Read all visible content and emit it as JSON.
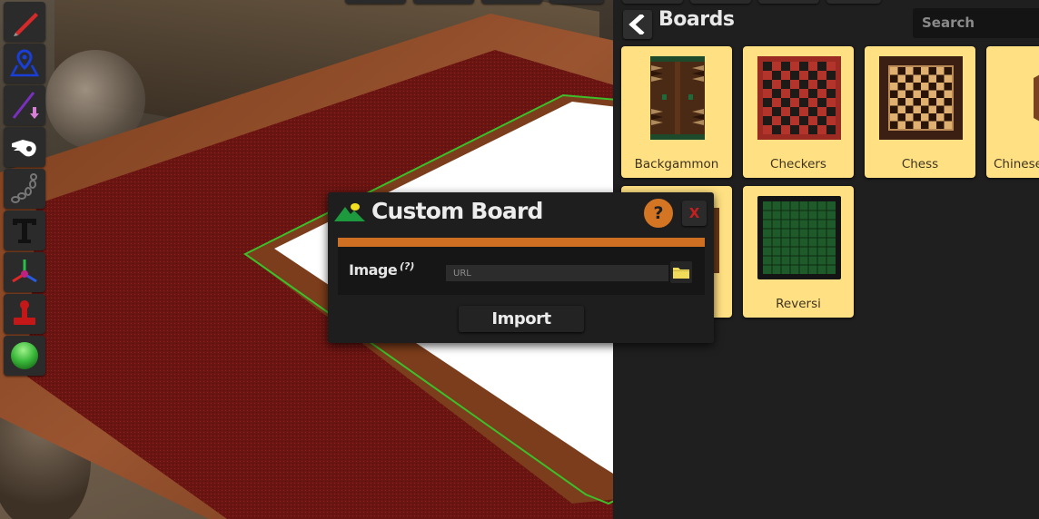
{
  "toolbar": {
    "tools": [
      {
        "name": "draw-tool",
        "icon": "pencil-icon"
      },
      {
        "name": "zone-tool",
        "icon": "map-pin-icon"
      },
      {
        "name": "line-tool",
        "icon": "line-arrow-icon"
      },
      {
        "name": "grab-tool",
        "icon": "hand-icon"
      },
      {
        "name": "joint-tool",
        "icon": "chain-icon"
      },
      {
        "name": "text-tool",
        "icon": "text-icon"
      },
      {
        "name": "gizmo-tool",
        "icon": "axes-icon"
      },
      {
        "name": "stamp-tool",
        "icon": "stamp-icon"
      },
      {
        "name": "flick-tool",
        "icon": "green-ball-icon"
      }
    ]
  },
  "panel": {
    "title": "Boards",
    "back_icon": "chevron-left-icon",
    "search_placeholder": "Search",
    "cards": [
      {
        "label": "Backgammon"
      },
      {
        "label": "Checkers"
      },
      {
        "label": "Chess"
      },
      {
        "label": "Chinese"
      },
      {
        "label": ""
      },
      {
        "label": "Reversi"
      }
    ]
  },
  "dialog": {
    "title": "Custom Board",
    "title_icon": "landscape-icon",
    "help_label": "?",
    "close_label": "X",
    "field_label": "Image",
    "field_hint": "(?)",
    "url_placeholder": "URL",
    "url_value": "",
    "folder_icon": "folder-icon",
    "import_label": "Import"
  },
  "colors": {
    "accent_orange": "#cf6f22",
    "card_yellow": "#ffe082",
    "panel_bg": "#1f1f1f",
    "close_red": "#c42020",
    "selection_green": "#3cbf2a"
  }
}
